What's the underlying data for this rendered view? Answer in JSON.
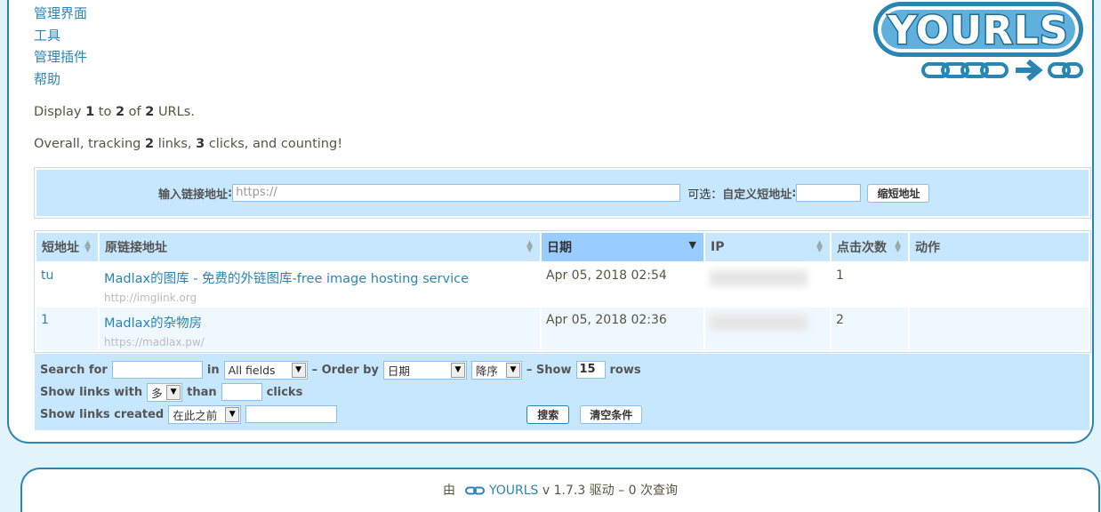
{
  "nav": {
    "items": [
      "管理界面",
      "工具",
      "管理插件",
      "帮助"
    ]
  },
  "logo_text": "YOURLS",
  "summary": {
    "display_prefix": "Display",
    "display_from": "1",
    "to": "to",
    "display_to": "2",
    "of": "of",
    "display_total": "2",
    "urls": "URLs.",
    "overall_prefix": "Overall, tracking",
    "links_count": "2",
    "links_word": "links,",
    "clicks_count": "3",
    "clicks_word": "clicks, and counting!"
  },
  "new_url": {
    "label": "输入链接地址",
    "colon": ":",
    "placeholder": "https://",
    "optional": "可选：",
    "keyword_label": "自定义短地址",
    "button": "缩短地址"
  },
  "table": {
    "headers": [
      "短地址",
      "原链接地址",
      "日期",
      "IP",
      "点击次数",
      "动作"
    ],
    "rows": [
      {
        "keyword": "tu",
        "title": "Madlax的图库 - 免费的外链图库-free image hosting service",
        "url": "http://imglink.org",
        "date": "Apr 05, 2018 02:54",
        "clicks": "1"
      },
      {
        "keyword": "1",
        "title": "Madlax的杂物房",
        "url": "https://madlax.pw/",
        "date": "Apr 05, 2018 02:36",
        "clicks": "2"
      }
    ]
  },
  "filter": {
    "search_for": "Search for",
    "in": "in",
    "field_select": "All fields",
    "order_by": "– Order by",
    "order_select": "日期",
    "direction_select": "降序",
    "show": "– Show",
    "rows_value": "15",
    "rows": "rows",
    "show_links_with": "Show links with",
    "compare_select": "多",
    "than": "than",
    "clicks": "clicks",
    "show_links_created": "Show links created",
    "created_select": "在此之前",
    "search_button": "搜索",
    "clear_button": "清空条件"
  },
  "footer": {
    "by": "由",
    "brand": "YOURLS",
    "version": "v 1.7.3 驱动 – 0 次查询"
  },
  "colors": {
    "accent": "#2a85b3",
    "header_bg": "#c7e7ff",
    "active_header_bg": "#99ccff",
    "page_bg": "#e3f3fc"
  }
}
